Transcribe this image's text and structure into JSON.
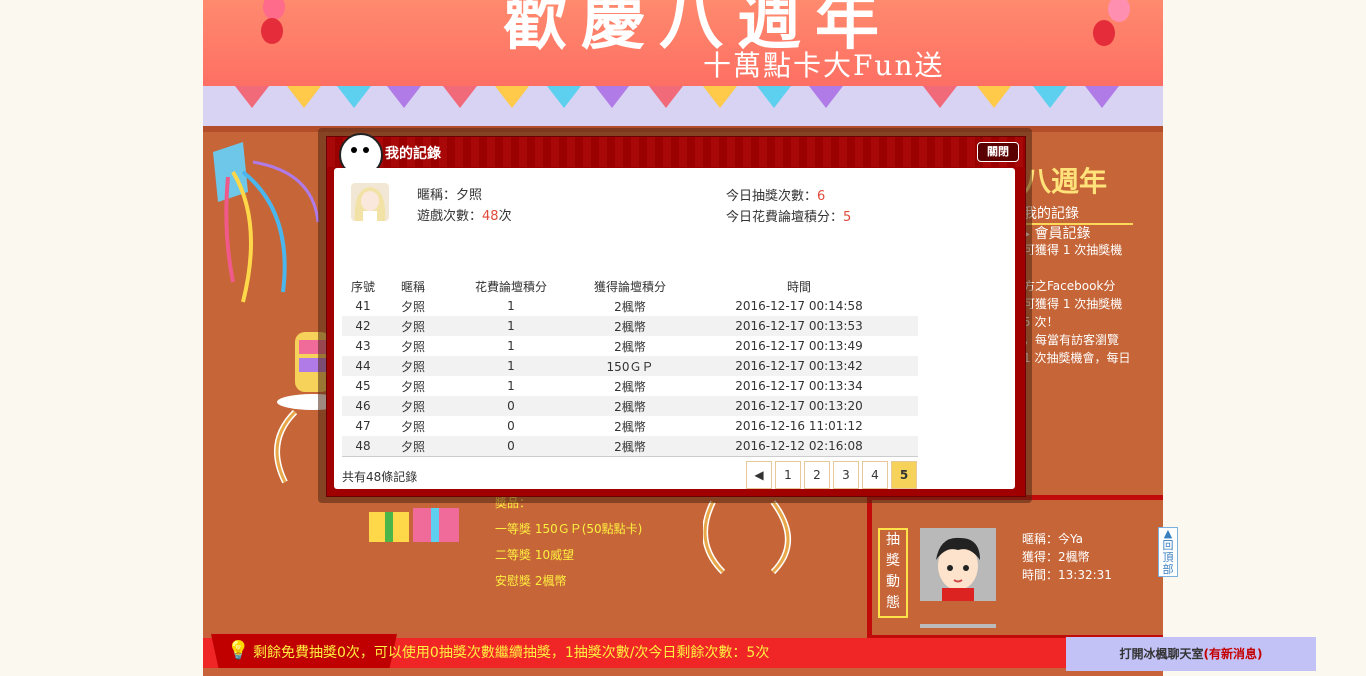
{
  "banner": {
    "title": "歡慶八週年",
    "subtitle": "十萬點卡大Fun送"
  },
  "right_panel": {
    "title": "八週年",
    "links": [
      "我的記錄",
      "會員記錄"
    ],
    "lines": [
      "可獲得 1 次抽獎機",
      "方之Facebook分",
      "可獲得 1 次抽獎機",
      "5 次！",
      "，每當有訪客瀏覽",
      "1 次抽獎機會，每日"
    ]
  },
  "prizes": {
    "heading": "獎品：",
    "first": "一等獎 150ＧＰ(50點點卡)",
    "second": "二等獎 10威望",
    "consolation": "安慰獎 2楓幣"
  },
  "live": {
    "tab_label": "抽獎動態",
    "nickname": "暱稱：今Ya",
    "won": "獲得：2楓幣",
    "time": "時間：13:32:31"
  },
  "bottom_bar": {
    "text": "剩餘免費抽獎0次，可以使用0抽獎次數繼續抽獎，1抽獎次數/次今日剩餘次數：5次"
  },
  "back_to_top": "回頂部",
  "chat": {
    "label": "打開冰楓聊天室",
    "new_msg": "(有新消息)"
  },
  "modal": {
    "title": "我的記錄",
    "close_label": "關閉",
    "user": {
      "nickname_label": "暱稱：",
      "nickname": "夕照",
      "games_label": "遊戲次數：",
      "games": "48",
      "games_unit": "次",
      "draws_today_label": "今日抽獎次數：",
      "draws_today": "6",
      "spent_today_label": "今日花費論壇積分：",
      "spent_today": "5"
    },
    "table": {
      "headers": [
        "序號",
        "暱稱",
        "花費論壇積分",
        "獲得論壇積分",
        "時間"
      ],
      "rows": [
        [
          "41",
          "夕照",
          "1",
          "2楓幣",
          "2016-12-17 00:14:58"
        ],
        [
          "42",
          "夕照",
          "1",
          "2楓幣",
          "2016-12-17 00:13:53"
        ],
        [
          "43",
          "夕照",
          "1",
          "2楓幣",
          "2016-12-17 00:13:49"
        ],
        [
          "44",
          "夕照",
          "1",
          "150ＧＰ",
          "2016-12-17 00:13:42"
        ],
        [
          "45",
          "夕照",
          "1",
          "2楓幣",
          "2016-12-17 00:13:34"
        ],
        [
          "46",
          "夕照",
          "0",
          "2楓幣",
          "2016-12-17 00:13:20"
        ],
        [
          "47",
          "夕照",
          "0",
          "2楓幣",
          "2016-12-16 11:01:12"
        ],
        [
          "48",
          "夕照",
          "0",
          "2楓幣",
          "2016-12-12 02:16:08"
        ]
      ]
    },
    "total": "共有48條記錄",
    "pager": {
      "prev": "◀",
      "pages": [
        "1",
        "2",
        "3",
        "4",
        "5"
      ],
      "current": "5"
    }
  }
}
